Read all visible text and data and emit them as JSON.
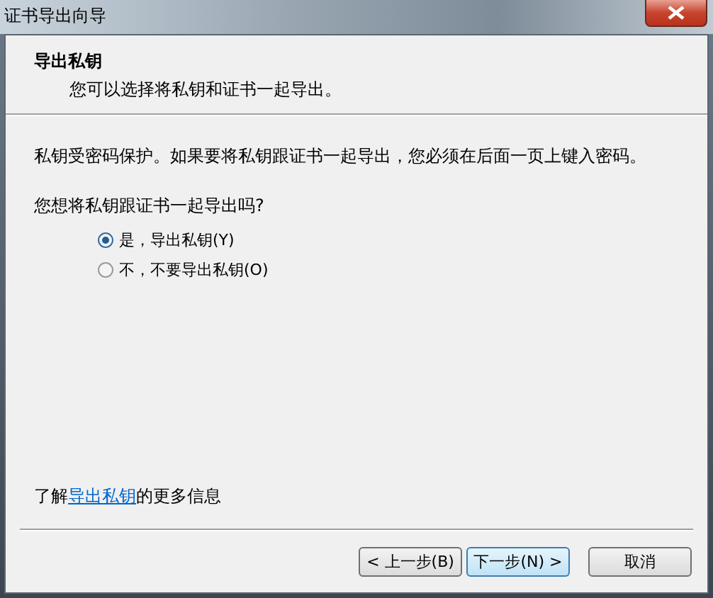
{
  "window": {
    "title": "证书导出向导"
  },
  "header": {
    "title": "导出私钥",
    "subtitle": "您可以选择将私钥和证书一起导出。"
  },
  "body": {
    "description": "私钥受密码保护。如果要将私钥跟证书一起导出，您必须在后面一页上键入密码。",
    "question": "您想将私钥跟证书一起导出吗?",
    "options": [
      {
        "label": "是，导出私钥(Y)",
        "selected": true
      },
      {
        "label": "不，不要导出私钥(O)",
        "selected": false
      }
    ]
  },
  "footer_info": {
    "before": "了解",
    "link": "导出私钥",
    "after": "的更多信息"
  },
  "buttons": [
    {
      "label": "< 上一步(B)",
      "default": false
    },
    {
      "label": "下一步(N) >",
      "default": true
    },
    {
      "label": "取消",
      "default": false
    }
  ]
}
